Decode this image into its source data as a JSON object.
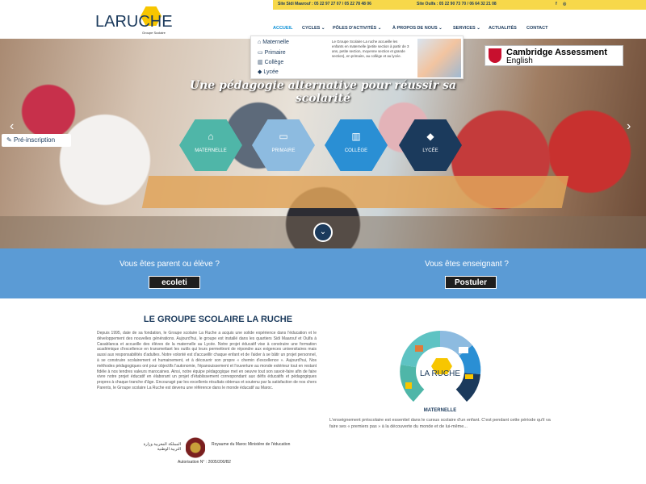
{
  "header": {
    "logo": {
      "la": "LA",
      "ruche": "RUCHE",
      "subtitle": "Groupe Scolaire"
    },
    "topbar": {
      "site1": "Site Sidi Maarouf : 05 22 97 27 07 / 05 22 78 48 06",
      "site2": "Site Oulfa : 05 22 90 73 70 / 06 64 32 21 08",
      "facebook": "f",
      "instagram": "◎"
    },
    "nav": {
      "accueil": "ACCUEIL",
      "cycles": "CYCLES ⌄",
      "poles": "PÔLES D'ACTIVITÉS ⌄",
      "apropos": "À PROPOS DE NOUS ⌄",
      "services": "SERVICES ⌄",
      "actualites": "ACTUALITÉS",
      "contact": "CONTACT"
    }
  },
  "dropdown": {
    "items": [
      "Maternelle",
      "Primaire",
      "Collège",
      "Lycée"
    ],
    "description": "Le Groupe Scolaire La ruche accueille les enfants en maternelle (petite section à partir de 3 ans, petite section, moyenne section et grande section), en primaire, au collège et au lycée."
  },
  "cambridge": {
    "line1": "Cambridge Assessment",
    "line2": "English"
  },
  "hero": {
    "title": "Une pédagogie alternative pour réussir sa scolarité",
    "pre_inscription": "Pré-inscription",
    "hex_labels": [
      "MATERNELLE",
      "PRIMAIRE",
      "COLLÈGE",
      "LYCÉE"
    ],
    "hex_colors": [
      "#4fb6a8",
      "#8dbbe0",
      "#2a8fd4",
      "#1b3a5c"
    ],
    "prev": "‹",
    "next": "›",
    "scroll": "⌄"
  },
  "band": {
    "parent_text": "Vous êtes parent ou élève ?",
    "parent_btn": "ecoleti",
    "teacher_text": "Vous êtes enseignant ?",
    "teacher_btn": "Postuler"
  },
  "about": {
    "title": "LE GROUPE SCOLAIRE LA RUCHE",
    "paragraph": "Depuis 1995, date de sa fondation, le Groupe scolaire La Ruche a acquis une solide expérience dans l'éducation et le développement des nouvelles générations. Aujourd'hui, le groupe est installé dans les quartiers Sidi Maarouf et Oulfa à Casablanca et accueille des élèves de la maternelle au Lycée. Notre projet éducatif vise à construire une formation académique d'excellence en transmettant les outils qui leurs permettront de répondre aux exigences universitaires mais aussi aux responsabilités d'adultes. Notre volonté est d'accueillir chaque enfant et de l'aider à se bâtir un projet personnel, à se construire scolairement et humainement, et à découvrir son propre « chemin d'excellence ». Aujourd'hui, Nos méthodes pédagogiques ont pour objectifs l'autonomie, l'épanouissement et l'ouverture au monde extérieur tout en restant fidèle à nos tendres valeurs marocaines. Ainsi, notre équipe pédagogique met en oeuvre tout son savoir-faire afin de faire vivre notre projet éducatif en élaborant un projet d'établissement correspondant aux défis éducatifs et pédagogiques propres à chaque tranche d'âge. Encouragé par les excellents résultats obtenus et soutenu par la satisfaction de nos chers Parents, le Groupe scolaire La Ruche est devenu une référence dans le monde éducatif au Maroc.",
    "ministry_ar": "المملكة المغربية وزارة التربية الوطنية",
    "ministry_fr": "Royaume du Maroc Ministère de l'éducation",
    "authorisation": "Autorisation N° : 2005/200/B2"
  },
  "wheel": {
    "label": "MATERNELLE",
    "description": "L'enseignement préscolaire est essentiel dans le cursus scolaire d'un enfant. C'est pendant cette période qu'il va faire ses « premiers pas » à la découverte du monde et de lui-même...",
    "colors": [
      "#8dbbe0",
      "#2a8fd4",
      "#1b3a5c",
      "#4fb6a8",
      "#5ec3c3"
    ]
  }
}
